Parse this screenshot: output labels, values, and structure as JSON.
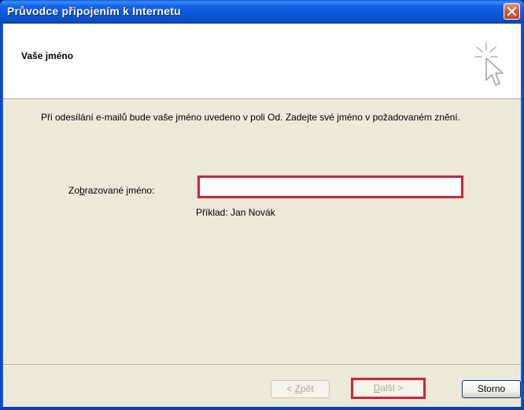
{
  "window": {
    "title": "Průvodce připojením k Internetu"
  },
  "header": {
    "title": "Vaše jméno",
    "icon": "wizard-cursor-icon"
  },
  "body": {
    "description": "Při odesílání e-mailů bude vaše jméno uvedeno v poli Od. Zadejte své jméno v požadovaném znění.",
    "field_label_pre": "Zo",
    "field_label_accel": "b",
    "field_label_post": "razované jméno:",
    "field_value": "",
    "example": "Příklad: Jan Novák"
  },
  "buttons": {
    "back_pre": "< ",
    "back_accel": "Z",
    "back_post": "pět",
    "next_accel": "D",
    "next_post": "alší >",
    "cancel": "Storno"
  },
  "colors": {
    "highlight": "#d9203a",
    "titlebar": "#0a58d8",
    "dialog_bg": "#ece9d8"
  }
}
